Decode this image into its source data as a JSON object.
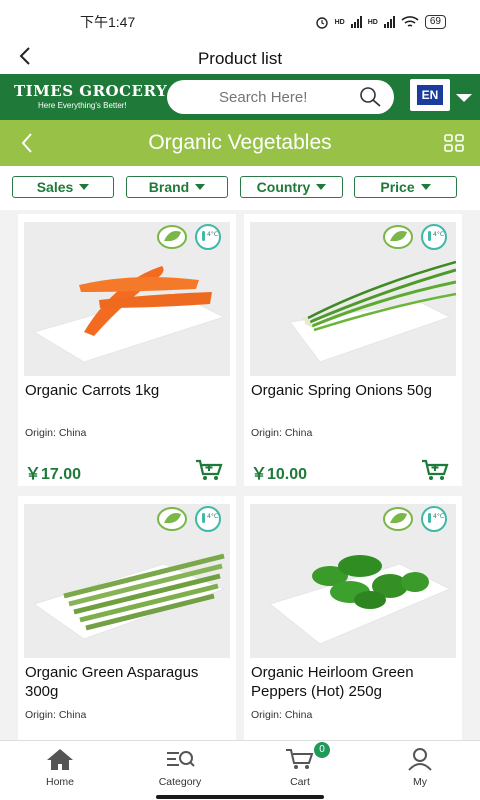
{
  "status_bar": {
    "time": "下午1:47",
    "battery": "69",
    "hd1": "HD",
    "hd2": "HD"
  },
  "header": {
    "title": "Product list"
  },
  "brand": {
    "logo_name": "TIMES GROCERY",
    "logo_tagline": "Here Everything's Better!",
    "search_placeholder": "Search Here!",
    "language": "EN"
  },
  "category": {
    "title": "Organic Vegetables"
  },
  "filters": [
    {
      "label": "Sales"
    },
    {
      "label": "Brand"
    },
    {
      "label": "Country"
    },
    {
      "label": "Price"
    }
  ],
  "badge_temp": "4°C",
  "products": [
    {
      "name": "Organic Carrots 1kg",
      "origin": "Origin: China",
      "price": "￥17.00",
      "image_icon": "carrot"
    },
    {
      "name": "Organic Spring Onions 50g",
      "origin": "Origin: China",
      "price": "￥10.00",
      "image_icon": "spring-onion"
    },
    {
      "name": "Organic Green Asparagus 300g",
      "origin": "Origin: China",
      "price": "",
      "image_icon": "asparagus"
    },
    {
      "name": "Organic Heirloom Green Peppers (Hot) 250g",
      "origin": "Origin: China",
      "price": "",
      "image_icon": "green-pepper"
    }
  ],
  "bottom_nav": {
    "items": [
      {
        "label": "Home",
        "icon": "home-icon"
      },
      {
        "label": "Category",
        "icon": "category-icon"
      },
      {
        "label": "Cart",
        "icon": "cart-icon"
      },
      {
        "label": "My",
        "icon": "person-icon"
      }
    ],
    "cart_count": "0"
  },
  "colors": {
    "brand_green": "#1f7a3a",
    "lime": "#97c247",
    "lang_blue": "#1a3c9c"
  }
}
